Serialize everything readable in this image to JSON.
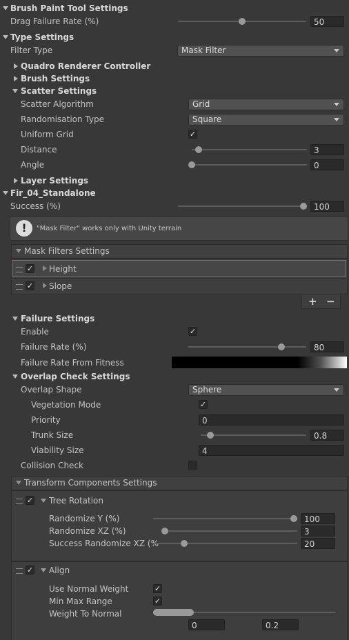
{
  "brush_paint": {
    "header": "Brush Paint Tool Settings",
    "drag_failure_label": "Drag Failure Rate (%)",
    "drag_failure_value": "50"
  },
  "type_settings": {
    "header": "Type Settings",
    "filter_type_label": "Filter Type",
    "filter_type_value": "Mask Filter",
    "quadro_header": "Quadro Renderer Controller",
    "brush_header": "Brush Settings",
    "scatter": {
      "header": "Scatter Settings",
      "algorithm_label": "Scatter Algorithm",
      "algorithm_value": "Grid",
      "randomisation_label": "Randomisation Type",
      "randomisation_value": "Square",
      "uniform_label": "Uniform Grid",
      "uniform_checked": true,
      "distance_label": "Distance",
      "distance_value": "3",
      "angle_label": "Angle",
      "angle_value": "0"
    },
    "layer_header": "Layer Settings"
  },
  "prototype": {
    "header": "Fir_04_Standalone",
    "success_label": "Success (%)",
    "success_value": "100",
    "help_badge": "!",
    "help_text": "\"Mask Filter\" works only with Unity terrain"
  },
  "mask_filters": {
    "header": "Mask Filters Settings",
    "items": [
      {
        "label": "Height",
        "checked": true
      },
      {
        "label": "Slope",
        "checked": true
      }
    ],
    "add": "+",
    "remove": "−"
  },
  "failure": {
    "header": "Failure Settings",
    "enable_label": "Enable",
    "enable_checked": true,
    "rate_label": "Failure Rate (%)",
    "rate_value": "80",
    "fitness_label": "Failure Rate From Fitness"
  },
  "overlap": {
    "header": "Overlap Check Settings",
    "shape_label": "Overlap Shape",
    "shape_value": "Sphere",
    "vegetation_label": "Vegetation Mode",
    "vegetation_checked": true,
    "priority_label": "Priority",
    "priority_value": "0",
    "trunk_label": "Trunk Size",
    "trunk_value": "0.8",
    "viability_label": "Viability Size",
    "viability_value": "4",
    "collision_label": "Collision Check",
    "collision_checked": false
  },
  "transform": {
    "header": "Transform Components Settings",
    "tree_rotation": {
      "label": "Tree Rotation",
      "checked": true,
      "randomize_y_label": "Randomize Y (%)",
      "randomize_y_value": "100",
      "randomize_xz_label": "Randomize XZ (%)",
      "randomize_xz_value": "3",
      "success_xz_label": "Success Randomize XZ (%",
      "success_xz_value": "20"
    },
    "align": {
      "label": "Align",
      "checked": true,
      "use_normal_label": "Use Normal Weight",
      "use_normal_checked": true,
      "min_max_label": "Min Max Range",
      "min_max_checked": true,
      "weight_label": "Weight To Normal",
      "weight_min": "0",
      "weight_max": "0.2"
    }
  },
  "slider_levels": {
    "drag_failure": 0.5,
    "distance": 0.06,
    "angle": 0.0,
    "success": 1.0,
    "failure_rate": 0.8,
    "trunk_size": 0.1,
    "randomize_y": 1.0,
    "randomize_xz": 0.08,
    "success_xz": 0.2,
    "weight_to_normal": [
      0.0,
      0.2
    ]
  },
  "colors": {
    "background": "#383838",
    "field": "#2a2a2a",
    "selection": "#4a7bb5"
  }
}
